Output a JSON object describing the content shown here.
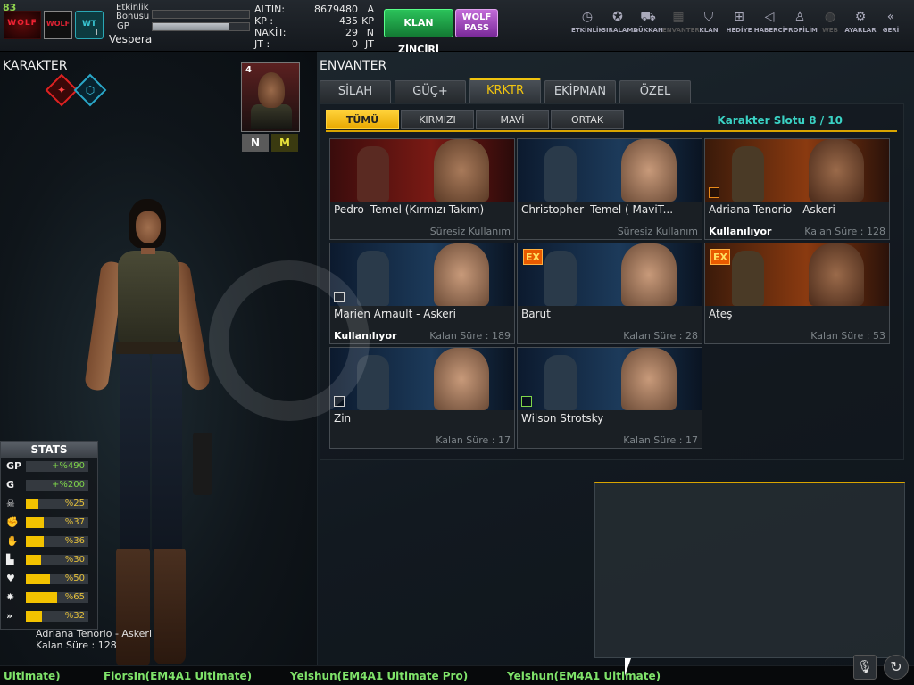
{
  "top_bar": {
    "level": "83",
    "clan_logos": [
      "WOLF",
      "WOLF",
      "WT"
    ],
    "rank": "I",
    "player_name": "Vespera",
    "etkinlik_bonusu_label": "Etkinlik Bonusu",
    "gp_label": "GP",
    "currency": [
      {
        "label": "ALTIN:",
        "value": "8679480",
        "unit": "A"
      },
      {
        "label": "KP :",
        "value": "435",
        "unit": "KP"
      },
      {
        "label": "NAKİT:",
        "value": "29",
        "unit": "N"
      },
      {
        "label": "JT :",
        "value": "0",
        "unit": "JT"
      }
    ],
    "clan_chain_label": "KLAN ZİNCİRİ",
    "wolf_pass_label": "WOLF PASS",
    "menu": [
      {
        "label": "ETKİNLİK",
        "icon": "clock-icon",
        "glyph": "◷"
      },
      {
        "label": "SIRALAMA",
        "icon": "medal-icon",
        "glyph": "✪"
      },
      {
        "label": "DÜKKAN",
        "icon": "cart-icon",
        "glyph": "⛟"
      },
      {
        "label": "ENVANTER",
        "icon": "inventory-icon",
        "glyph": "▦"
      },
      {
        "label": "KLAN",
        "icon": "shield-icon",
        "glyph": "⛉"
      },
      {
        "label": "HEDİYE",
        "icon": "gift-icon",
        "glyph": "⊞"
      },
      {
        "label": "HABERCİ",
        "icon": "megaphone-icon",
        "glyph": "◁"
      },
      {
        "label": "PROFİLİM",
        "icon": "profile-icon",
        "glyph": "♙"
      },
      {
        "label": "WEB",
        "icon": "globe-icon",
        "glyph": "◍"
      },
      {
        "label": "AYARLAR",
        "icon": "gear-icon",
        "glyph": "⚙"
      },
      {
        "label": "GERİ",
        "icon": "back-icon",
        "glyph": "«"
      }
    ]
  },
  "left": {
    "title": "KARAKTER",
    "mode_icons": [
      "✦",
      "⬡"
    ],
    "char_card": {
      "number": "4"
    },
    "n_button": "N",
    "m_button": "M",
    "stats_title": "STATS",
    "stats": [
      {
        "key": "GP",
        "value": "+%490",
        "fill": 0.0,
        "icon": "gp"
      },
      {
        "key": "G",
        "value": "+%200",
        "fill": 0.0,
        "icon": "gold"
      },
      {
        "key": "☠",
        "value": "%25",
        "fill": 0.2,
        "icon": "skull-icon"
      },
      {
        "key": "✊",
        "value": "%37",
        "fill": 0.28,
        "icon": "fist-icon"
      },
      {
        "key": "✋",
        "value": "%36",
        "fill": 0.28,
        "icon": "hand-icon"
      },
      {
        "key": "▙",
        "value": "%30",
        "fill": 0.24,
        "icon": "boot-icon"
      },
      {
        "key": "♥",
        "value": "%50",
        "fill": 0.38,
        "icon": "heart-icon"
      },
      {
        "key": "✸",
        "value": "%65",
        "fill": 0.5,
        "icon": "burst-icon"
      },
      {
        "key": "»",
        "value": "%32",
        "fill": 0.25,
        "icon": "speed-icon"
      }
    ],
    "caption_name": "Adriana Tenorio - Askeri",
    "caption_time": "Kalan Süre : 128"
  },
  "right": {
    "title": "ENVANTER",
    "main_tabs": [
      "SİLAH",
      "GÜÇ+",
      "KRKTR",
      "EKİPMAN",
      "ÖZEL"
    ],
    "active_main_tab": "KRKTR",
    "filter_tabs": [
      "TÜMÜ",
      "KIRMIZI",
      "MAVİ",
      "ORTAK"
    ],
    "active_filter_tab": "TÜMÜ",
    "slot_label": "Karakter Slotu 8 / 10",
    "cards": [
      {
        "name": "Pedro -Temel (Kırmızı Takım)",
        "status": "",
        "duration": "Süresiz Kullanım",
        "ex": false,
        "check": "",
        "theme": "red"
      },
      {
        "name": "Christopher -Temel ( MaviT...",
        "status": "",
        "duration": "Süresiz Kullanım",
        "ex": false,
        "check": "",
        "theme": "blue"
      },
      {
        "name": "Adriana Tenorio - Askeri",
        "status": "Kullanılıyor",
        "duration": "Kalan Süre : 128",
        "ex": false,
        "check": "orange",
        "theme": "orange"
      },
      {
        "name": "Marien Arnault - Askeri",
        "status": "Kullanılıyor",
        "duration": "Kalan Süre : 189",
        "ex": false,
        "check": "white",
        "theme": "blue"
      },
      {
        "name": "Barut",
        "status": "",
        "duration": "Kalan Süre : 28",
        "ex": true,
        "ex_label": "EX",
        "check": "",
        "theme": "blue"
      },
      {
        "name": "Ateş",
        "status": "",
        "duration": "Kalan Süre : 53",
        "ex": true,
        "ex_label": "EX",
        "check": "",
        "theme": "orange"
      },
      {
        "name": "Zin",
        "status": "",
        "duration": "Kalan Süre : 17",
        "ex": false,
        "check": "white",
        "theme": "blue"
      },
      {
        "name": "Wilson Strotsky",
        "status": "",
        "duration": "Kalan Süre : 17",
        "ex": false,
        "check": "green",
        "theme": "blue"
      }
    ]
  },
  "ticker": [
    "Ultimate)",
    "FlorsIn(EM4A1 Ultimate)",
    "Yeishun(EM4A1 Ultimate Pro)",
    "Yeishun(EM4A1 Ultimate)"
  ],
  "mic_icon": "🎙",
  "refresh_icon": "↻",
  "colors": {
    "accent": "#f1c40f",
    "slot": "#3ad2c4",
    "ticker": "#7fe36a",
    "stat_fill": "#f2c200"
  }
}
